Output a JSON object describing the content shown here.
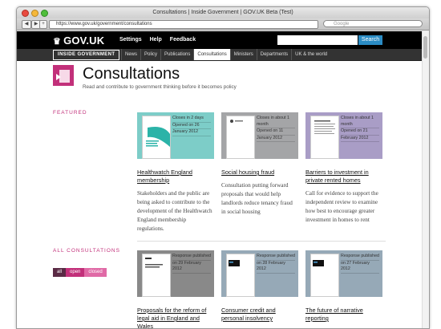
{
  "browser": {
    "window_title": "Consultations | Inside Government | GOV.UK Beta (Test)",
    "url": "https://www.gov.uk/government/consultations",
    "search_placeholder": "Google"
  },
  "header": {
    "logo": "GOV.UK",
    "nav": [
      "Settings",
      "Help",
      "Feedback"
    ],
    "search_button": "Search"
  },
  "subnav": {
    "badge": "INSIDE GOVERNMENT",
    "items": [
      "News",
      "Policy",
      "Publications",
      "Consultations",
      "Ministers",
      "Departments",
      "UK & the world"
    ],
    "active": "Consultations"
  },
  "page": {
    "title": "Consultations",
    "subtitle": "Read and contribute to government thinking before it becomes policy"
  },
  "featured": {
    "label": "FEATURED",
    "cards": [
      {
        "status": "Closes in 2 days",
        "opened_label": "Opened on 26",
        "opened_date": "January 2012",
        "title": "Healthwatch England membership",
        "description": "Stakeholders and the public are being asked to contribute to the development of the Healthwatch England membership regulations.",
        "color": "#7dcdc8"
      },
      {
        "status": "Closes in about 1 month",
        "opened_label": "Opened on 11",
        "opened_date": "January 2012",
        "title": "Social housing fraud",
        "description": "Consultation putting forward proposals that would help landlords reduce tenancy fraud in social housing",
        "color": "#a4a5a7"
      },
      {
        "status": "Closes in about 1 month",
        "opened_label": "Opened on 21",
        "opened_date": "February 2012",
        "title": "Barriers to investment in private rented homes",
        "description": "Call for evidence to support the independent review to examine how best to encourage greater investment in homes to rent",
        "color": "#a99dc6"
      }
    ]
  },
  "all": {
    "label": "ALL CONSULTATIONS",
    "filters": [
      "all",
      "open",
      "closed"
    ],
    "cards": [
      {
        "status": "Response published",
        "date": "on 29 February 2012",
        "title": "Proposals for the reform of legal aid in England and Wales",
        "color": "#898989"
      },
      {
        "status": "Response published",
        "date": "on 28 February 2012",
        "title": "Consumer credit and personal insolvency",
        "color": "#96a9b7"
      },
      {
        "status": "Response published",
        "date": "on 27 February 2012",
        "title": "The future of narrative reporting",
        "color": "#96a9b7"
      }
    ]
  }
}
